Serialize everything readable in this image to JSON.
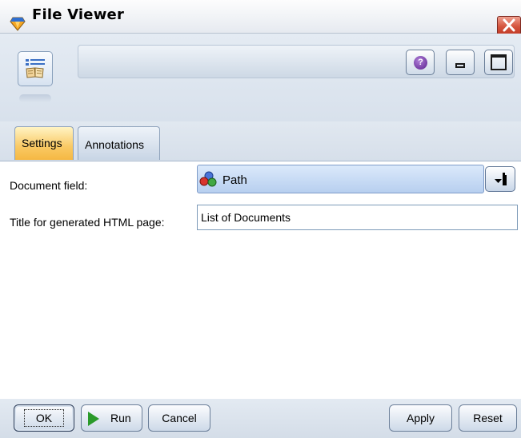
{
  "window": {
    "title": "File Viewer"
  },
  "tabs": [
    {
      "label": "Settings",
      "selected": true
    },
    {
      "label": "Annotations",
      "selected": false
    }
  ],
  "form": {
    "document_field_label": "Document field:",
    "document_field_value": "Path",
    "title_label": "Title for generated HTML page:",
    "title_value": "List of Documents"
  },
  "buttons": {
    "ok": "OK",
    "run": "Run",
    "cancel": "Cancel",
    "apply": "Apply",
    "reset": "Reset"
  },
  "icons": {
    "app": "diamond-icon",
    "close": "close-icon",
    "node": "file-viewer-node-icon",
    "help": "help-icon",
    "minimize": "minimize-icon",
    "maximize": "maximize-icon",
    "field": "set-field-icon",
    "dropdown": "field-picker-icon",
    "run": "play-icon"
  },
  "colors": {
    "selected_tab": "#f9c964",
    "close_button": "#d5553e",
    "help_icon": "#5a1f8e",
    "run_icon": "#2a9a2a"
  }
}
